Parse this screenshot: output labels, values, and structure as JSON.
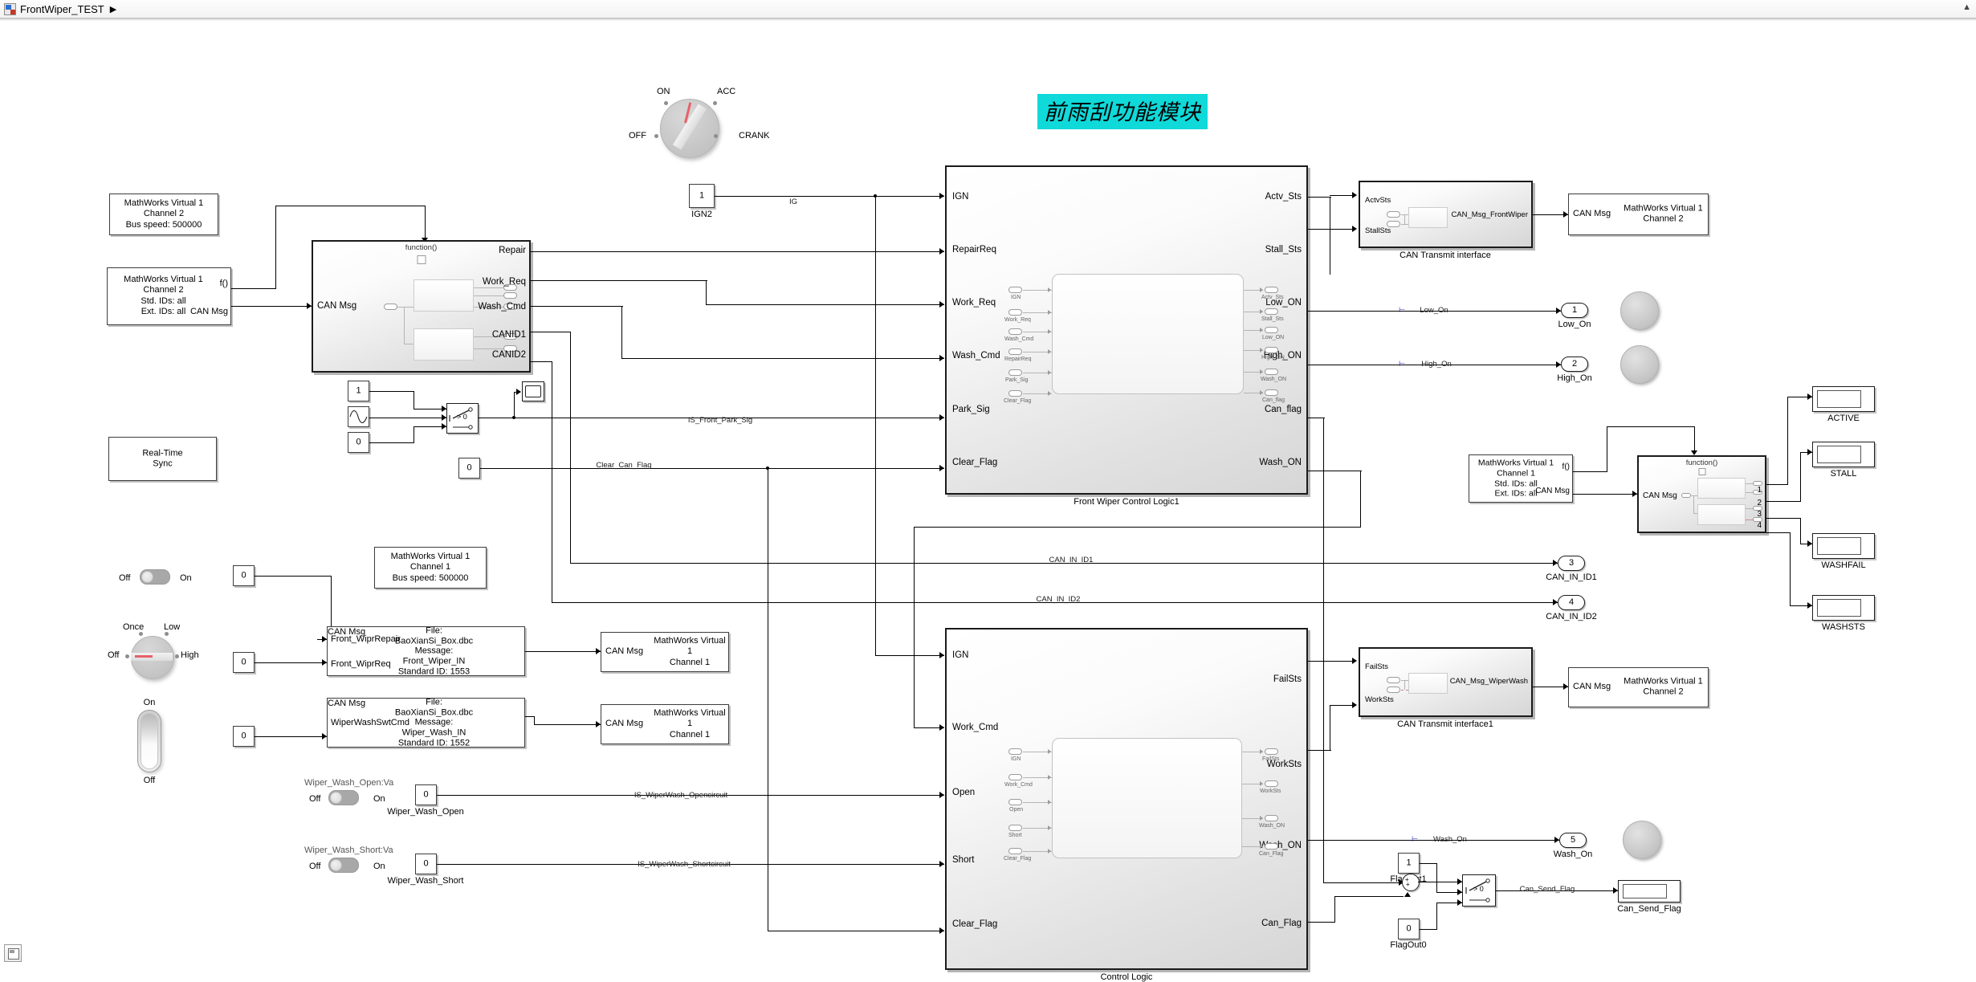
{
  "titlebar": {
    "title": "FrontWiper_TEST",
    "breadcrumb_arrow": "▶",
    "icon": "model-icon",
    "collapse_arrow": "▲"
  },
  "annotation": {
    "text": "前雨刮功能模块",
    "bg": "#10d9d9"
  },
  "ignition_knob": {
    "labels": {
      "off": "OFF",
      "on": "ON",
      "acc": "ACC",
      "crank": "CRANK"
    },
    "position": "ON"
  },
  "constants": {
    "ign2": {
      "value": "1",
      "label": "IGN2"
    },
    "one_top": "1",
    "zero_mid": "0",
    "clear_zero": "0",
    "front_wipr_repair_in": "0",
    "front_wipr_req_in": "0",
    "wiper_wash_swt_in": "0",
    "wiper_wash_open": {
      "value": "0",
      "label": "Wiper_Wash_Open"
    },
    "wiper_wash_short": {
      "value": "0",
      "label": "Wiper_Wash_Short"
    },
    "flag_out1": {
      "value": "1",
      "label": "FlagOut1"
    },
    "flag_out0": {
      "value": "0",
      "label": "FlagOut0"
    }
  },
  "can_blocks": {
    "config_ch2": {
      "lines": [
        "MathWorks Virtual 1",
        "Channel 2",
        "Bus speed: 500000"
      ]
    },
    "receive_ch2": {
      "lines": [
        "MathWorks Virtual 1",
        "Channel 2",
        "Std. IDs: all",
        "Ext. IDs: all"
      ],
      "port_f": "f()",
      "port_msg": "CAN Msg"
    },
    "config_ch1": {
      "lines": [
        "MathWorks Virtual 1",
        "Channel 1",
        "Bus speed: 500000"
      ]
    },
    "receive_ch1": {
      "lines": [
        "MathWorks Virtual 1",
        "Channel 1",
        "Std. IDs: all",
        "Ext. IDs: all"
      ],
      "port_f": "f()",
      "port_msg": "CAN Msg"
    },
    "transmit_ch1_a": {
      "lines": [
        "MathWorks Virtual 1",
        "Channel 1"
      ],
      "port_msg": "CAN Msg"
    },
    "transmit_ch1_b": {
      "lines": [
        "MathWorks Virtual 1",
        "Channel 1"
      ],
      "port_msg": "CAN Msg"
    },
    "transmit_ch2_a": {
      "lines": [
        "MathWorks Virtual 1",
        "Channel 2"
      ],
      "port_msg": "CAN Msg"
    },
    "transmit_ch2_b": {
      "lines": [
        "MathWorks Virtual 1",
        "Channel 2"
      ],
      "port_msg": "CAN Msg"
    }
  },
  "realtime_sync": {
    "lines": [
      "Real-Time",
      "Sync"
    ]
  },
  "unpack_subsystem": {
    "function_label": "function()",
    "in_port": "CAN Msg",
    "out_ports": [
      "Repair",
      "Work_Req",
      "Wash_Cmd",
      "CANID1",
      "CANID2"
    ]
  },
  "front_wiper_logic": {
    "name": "Front Wiper Control Logic1",
    "inputs": [
      "IGN",
      "RepairReq",
      "Work_Req",
      "Wash_Cmd",
      "Park_Sig",
      "Clear_Flag"
    ],
    "outputs": [
      "Actv_Sts",
      "Stall_Sts",
      "Low_ON",
      "High_ON",
      "Can_flag",
      "Wash_ON"
    ],
    "inner_in": [
      "IGN",
      "Work_Req",
      "Wash_Cmd",
      "RepairReq",
      "Park_Sig",
      "Clear_Flag"
    ],
    "inner_out": [
      "Actv_Sts",
      "Stall_Sts",
      "Low_ON",
      "High_ON",
      "Wash_ON",
      "Can_flag"
    ]
  },
  "control_logic": {
    "name": "Control Logic",
    "inputs": [
      "IGN",
      "Work_Cmd",
      "Open",
      "Short",
      "Clear_Flag"
    ],
    "outputs": [
      "FailSts",
      "WorkSts",
      "Wash_ON",
      "Can_Flag"
    ],
    "inner_in": [
      "IGN",
      "Work_Cmd",
      "Open",
      "Short",
      "Clear_Flag"
    ],
    "inner_out": [
      "FailSts",
      "WorkSts",
      "Wash_ON",
      "Can_Flag"
    ]
  },
  "can_transmit_interface": {
    "name": "CAN Transmit interface",
    "inputs": [
      "ActvSts",
      "StallSts"
    ],
    "output": "CAN_Msg_FrontWiper"
  },
  "can_transmit_interface1": {
    "name": "CAN Transmit interface1",
    "inputs": [
      "FailSts",
      "WorkSts"
    ],
    "output": "CAN_Msg_WiperWash"
  },
  "can_rx_decode": {
    "function_label": "function()",
    "in_port": "CAN Msg",
    "out_ports": [
      "1",
      "2",
      "3",
      "4"
    ]
  },
  "can_pack_front_wiper": {
    "inputs": [
      "Front_WiprRepair",
      "Front_WiprReq"
    ],
    "lines": [
      "File: BaoXianSi_Box.dbc",
      "Message: Front_Wiper_IN",
      "Standard ID: 1553"
    ],
    "output": "CAN Msg"
  },
  "can_pack_wiper_wash": {
    "inputs": [
      "WiperWashSwtCmd"
    ],
    "lines": [
      "File: BaoXianSi_Box.dbc",
      "Message: Wiper_Wash_IN",
      "Standard ID: 1552"
    ],
    "output": "CAN Msg"
  },
  "widgets": {
    "ign_switch": {
      "off": "Off",
      "on": "On",
      "state": "Off"
    },
    "wiper_knob": {
      "once": "Once",
      "low": "Low",
      "off": "Off",
      "high": "High",
      "position": "Off"
    },
    "rocker": {
      "on": "On",
      "off": "Off",
      "state": "Off"
    },
    "wash_open_switch": {
      "title": "Wiper_Wash_Open:Va",
      "off": "Off",
      "on": "On",
      "state": "Off"
    },
    "wash_short_switch": {
      "title": "Wiper_Wash_Short:Va",
      "off": "Off",
      "on": "On",
      "state": "Off"
    }
  },
  "signal_labels": {
    "ig": "IG",
    "is_front_park_sig": "IS_Front_Park_Sig",
    "clear_can_flag": "Clear_Can_Flag",
    "can_in_id1": "CAN_IN_ID1",
    "can_in_id2": "CAN_IN_ID2",
    "is_wiperwash_opencircuit": "IS_WiperWash_Opencircuit",
    "is_wiperwash_shortcircuit": "IS_WiperWash_Shortcircuit",
    "can_send_flag": "Can_Send_Flag",
    "low_on": "Low_On",
    "high_on": "High_On",
    "wash_on": "Wash_On"
  },
  "outports": [
    {
      "num": "1",
      "label": "Low_On"
    },
    {
      "num": "2",
      "label": "High_On"
    },
    {
      "num": "3",
      "label": "CAN_IN_ID1"
    },
    {
      "num": "4",
      "label": "CAN_IN_ID2"
    },
    {
      "num": "5",
      "label": "Wash_On"
    }
  ],
  "displays": [
    {
      "label": "ACTIVE"
    },
    {
      "label": "STALL"
    },
    {
      "label": "WASHFAIL"
    },
    {
      "label": "WASHSTS"
    },
    {
      "label": "Can_Send_Flag"
    }
  ],
  "switch_block": {
    "criteria": "> 0"
  },
  "sum_block": {
    "signs": "+ +"
  }
}
